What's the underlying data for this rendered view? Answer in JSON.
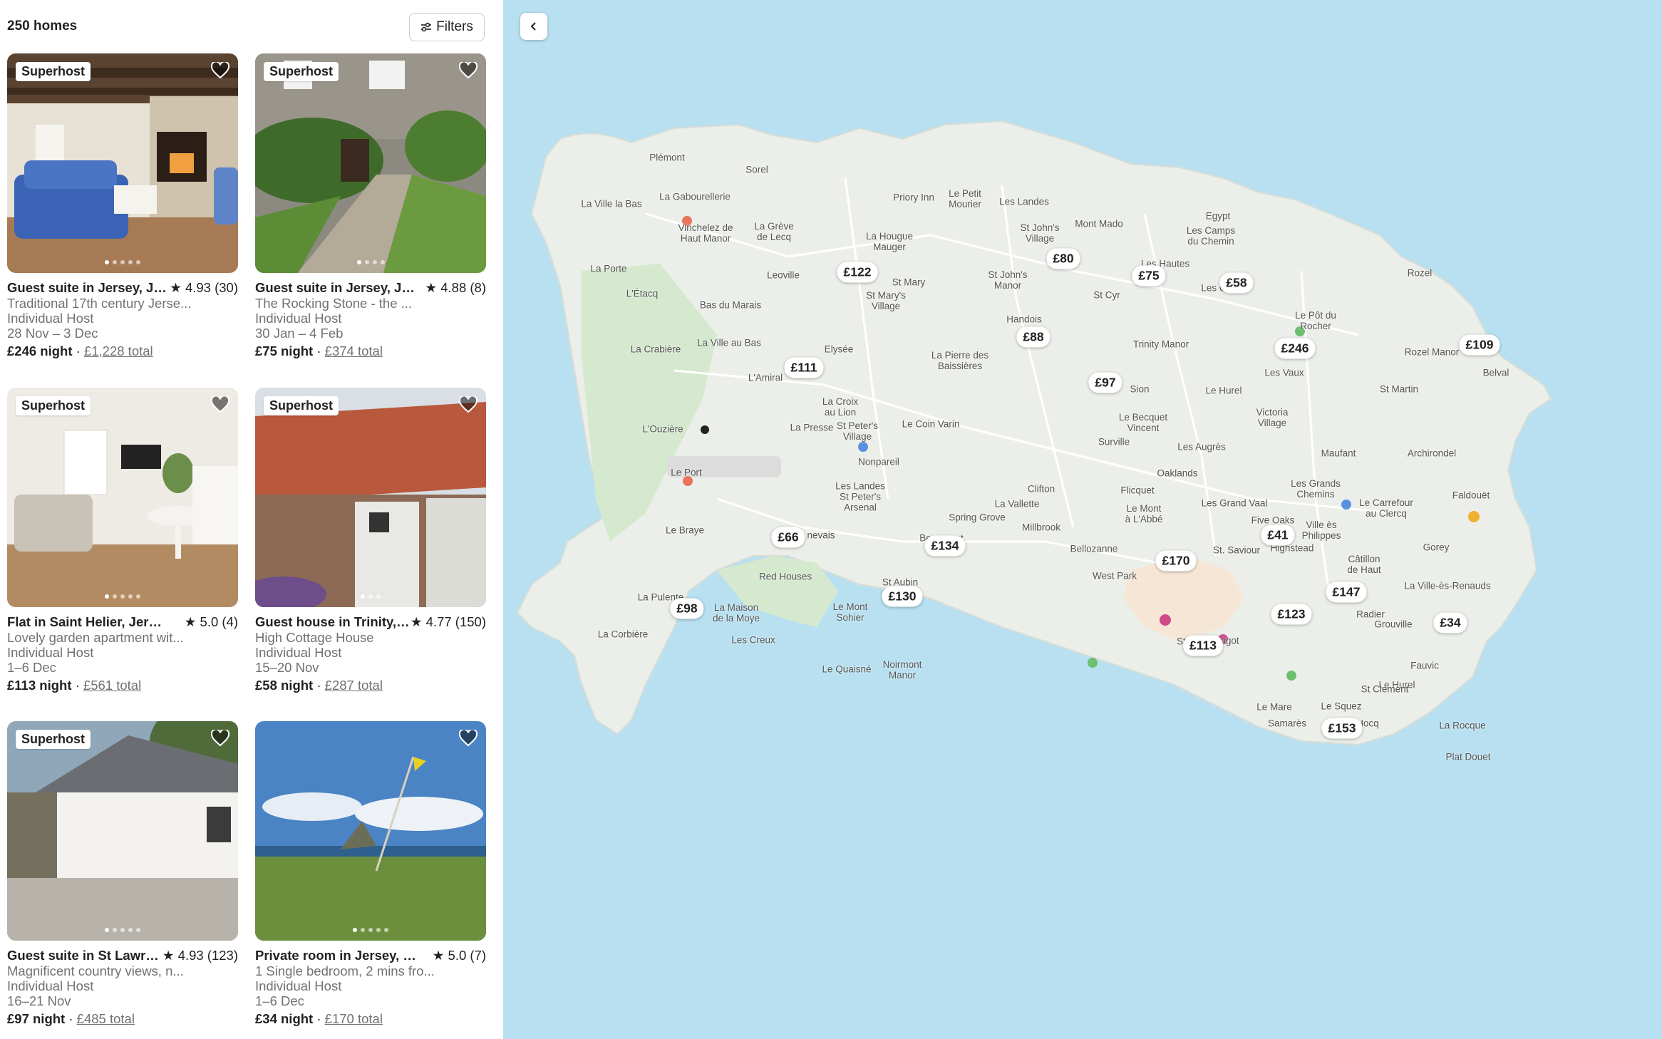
{
  "results": {
    "count_label": "250 homes",
    "filters_label": "Filters"
  },
  "listings": [
    {
      "badge": "Superhost",
      "title": "Guest suite in Jersey, Jer...",
      "rating": "4.93 (30)",
      "subtitle": "Traditional 17th century Jerse...",
      "host": "Individual Host",
      "dates": "28 Nov – 3 Dec",
      "price": "£246 night",
      "total": "£1,228 total"
    },
    {
      "badge": "Superhost",
      "title": "Guest suite in Jersey, Jers...",
      "rating": "4.88 (8)",
      "subtitle": "The Rocking Stone   - the ...",
      "host": "Individual Host",
      "dates": "30 Jan – 4 Feb",
      "price": "£75 night",
      "total": "£374 total"
    },
    {
      "badge": "Superhost",
      "title": "Flat in Saint Helier, Jersey",
      "rating": "5.0 (4)",
      "subtitle": "Lovely garden apartment wit...",
      "host": "Individual Host",
      "dates": "1–6 Dec",
      "price": "£113 night",
      "total": "£561 total"
    },
    {
      "badge": "Superhost",
      "title": "Guest house in Trinity, J...",
      "rating": "4.77 (150)",
      "subtitle": "High Cottage House",
      "host": "Individual Host",
      "dates": "15–20 Nov",
      "price": "£58 night",
      "total": "£287 total"
    },
    {
      "badge": "Superhost",
      "title": "Guest suite in St Lawre...",
      "rating": "4.93 (123)",
      "subtitle": "Magnificent country views, n...",
      "host": "Individual Host",
      "dates": "16–21 Nov",
      "price": "£97 night",
      "total": "£485 total"
    },
    {
      "badge": "",
      "title": "Private room in Jersey, Jers...",
      "rating": "5.0 (7)",
      "subtitle": "1 Single bedroom, 2 mins fro...",
      "host": "Individual Host",
      "dates": "1–6 Dec",
      "price": "£34 night",
      "total": "£170 total"
    }
  ],
  "separator": " · ",
  "map": {
    "price_pins": [
      "£122",
      "£80",
      "£75",
      "£58",
      "£88",
      "£246",
      "£109",
      "£111",
      "£97",
      "£66",
      "£134",
      "£170",
      "£41",
      "£98",
      "£130",
      "£147",
      "£123",
      "£34",
      "£113",
      "£153"
    ],
    "places": [
      "Plémont",
      "Sorel",
      "La Ville la Bas",
      "La Gabourellerie",
      "Priory Inn",
      "Le Petit\nMourier",
      "Les Landes",
      "Egypt",
      "Mont Mado",
      "Les Camps\ndu Chemin",
      "La Grève\nde Lecq",
      "Vinchelez de\nHaut Manor",
      "La Hougue\nMauger",
      "St John's\nVillage",
      "Les Hautes",
      "Rozel",
      "La Porte",
      "Leoville",
      "St Mary",
      "St Mary's\nVillage",
      "St John's\nManor",
      "L'Étacq",
      "Bas du Marais",
      "St Cyr",
      "Les C",
      "Le Pôt du\nRocher",
      "Handois",
      "Rozel Manor",
      "La Crabière",
      "La Ville au Bas",
      "Elysée",
      "Trinity Manor",
      "Belval",
      "La Pierre des\nBaissières",
      "L'Amiral",
      "Sion",
      "Le Hurel",
      "Les Vaux",
      "St Martin",
      "La Croix\nau Lion",
      "Le Becquet\nVincent",
      "Victoria\nVillage",
      "L'Ouzière",
      "La Presse",
      "St Peter's\nVillage",
      "Le Coin Varin",
      "Surville",
      "Les Augrès",
      "Archirondel",
      "Nonpareil",
      "Maufant",
      "Le Port",
      "Les Landes\nSt Peter's\nArsenal",
      "Clifton",
      "Oaklands",
      "Les Grands\nChemins",
      "Flicquet",
      "Le Carrefour\nau Clercq",
      "Faldouët",
      "La Vallette",
      "Le Mont\nà L'Abbé",
      "Les Grand Vaal",
      "Ville ès\nPhilippes",
      "Spring Grove",
      "Five Oaks",
      "Le Braye",
      "Millbrook",
      "Highstead",
      "Gorey",
      "nevais",
      "Bellozanne",
      "St. Saviour",
      "Câtillon\nde Haut",
      "Beaumont",
      "West Park",
      "Red Houses",
      "La Ville-ès-Renauds",
      "St Aubin",
      "La Pulente",
      "La Maison\nde la Moye",
      "Le Mont\nSohier",
      "Radier",
      "Grouville",
      "Les Creux",
      "St He",
      "Bagot",
      "La Corbière",
      "Noirmont\nManor",
      "Le Quaisné",
      "Fauvic",
      "Le Hurel",
      "St Clement",
      "Le Squez",
      "Le Mare",
      "Samarès",
      "Hocq",
      "La Rocque",
      "Plat Douet"
    ]
  }
}
